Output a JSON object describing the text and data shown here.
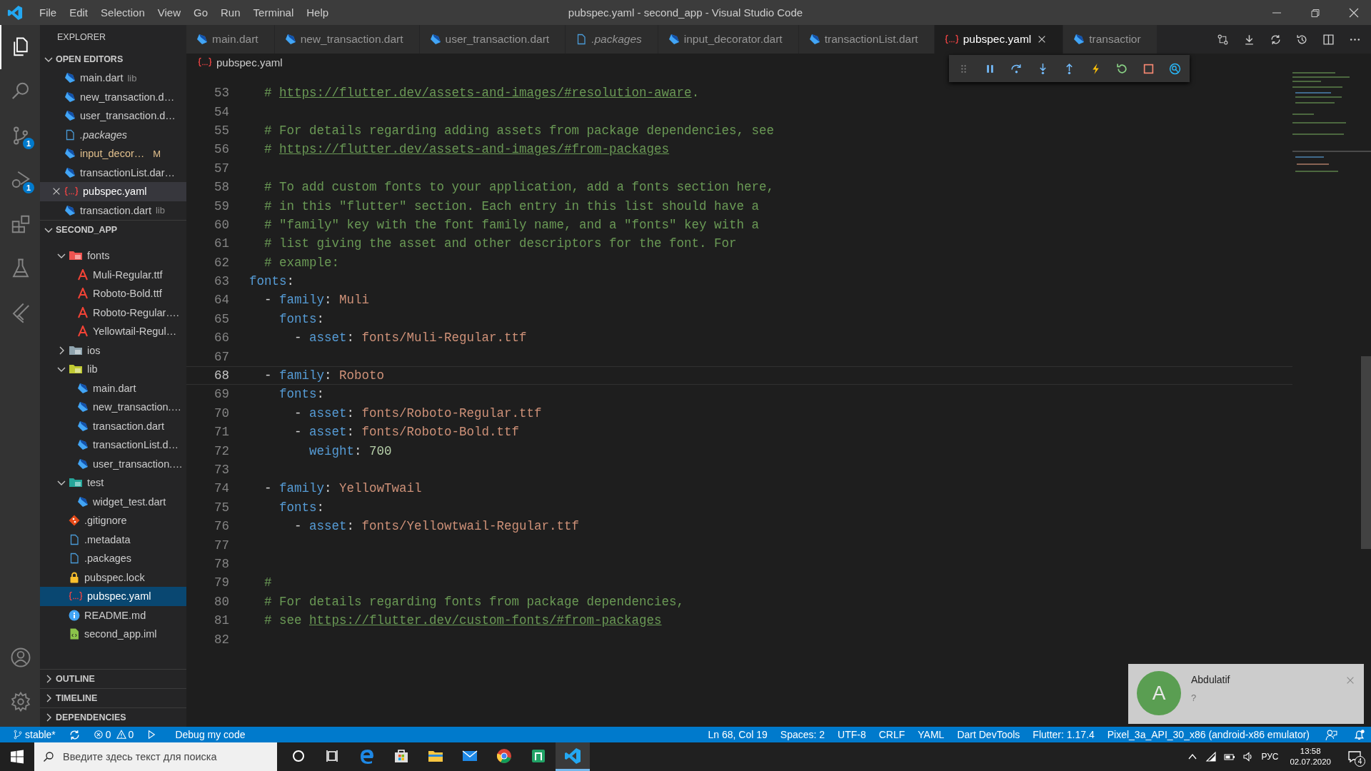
{
  "window": {
    "title": "pubspec.yaml - second_app - Visual Studio Code"
  },
  "menu": [
    "File",
    "Edit",
    "Selection",
    "View",
    "Go",
    "Run",
    "Terminal",
    "Help"
  ],
  "activity_bar": [
    {
      "kind": "explorer",
      "selected": true
    },
    {
      "kind": "search",
      "selected": false
    },
    {
      "kind": "source-control",
      "selected": false,
      "badge": "1"
    },
    {
      "kind": "run",
      "selected": false,
      "badge": "1"
    },
    {
      "kind": "extensions",
      "selected": false
    },
    {
      "kind": "testing",
      "selected": false
    },
    {
      "kind": "flutter",
      "selected": false
    }
  ],
  "activity_bar_bottom": [
    {
      "kind": "account"
    },
    {
      "kind": "settings"
    }
  ],
  "explorer": {
    "title": "EXPLORER",
    "open_editors": {
      "title": "OPEN EDITORS",
      "expanded": true,
      "items": [
        {
          "name": "main.dart",
          "kind": "dart",
          "detail": "lib",
          "preview": false,
          "selected": false
        },
        {
          "name": "new_transaction.d…",
          "kind": "dart",
          "preview": false,
          "selected": false
        },
        {
          "name": "user_transaction.d…",
          "kind": "dart",
          "preview": false,
          "selected": false
        },
        {
          "name": ".packages",
          "kind": "file",
          "preview": true,
          "selected": false
        },
        {
          "name": "input_decor…",
          "kind": "dart",
          "git_status": "M",
          "preview": false,
          "selected": false
        },
        {
          "name": "transactionList.dar…",
          "kind": "dart",
          "preview": false,
          "selected": false
        },
        {
          "name": "pubspec.yaml",
          "kind": "yaml",
          "preview": false,
          "selected": true
        },
        {
          "name": "transaction.dart",
          "kind": "dart",
          "detail": "lib",
          "preview": false,
          "selected": false
        }
      ]
    },
    "project": {
      "title": "SECOND_APP",
      "expanded": true,
      "tree": [
        {
          "name": "fonts",
          "kind": "folder-font",
          "expanded": true,
          "selected": false,
          "children": [
            {
              "name": "Muli-Regular.ttf",
              "kind": "font",
              "selected": false
            },
            {
              "name": "Roboto-Bold.ttf",
              "kind": "font",
              "selected": false
            },
            {
              "name": "Roboto-Regular….",
              "kind": "font",
              "selected": false
            },
            {
              "name": "Yellowtail-Regul…",
              "kind": "font",
              "selected": false
            }
          ]
        },
        {
          "name": "ios",
          "kind": "folder-ios",
          "expanded": false,
          "selected": false
        },
        {
          "name": "lib",
          "kind": "folder-lib",
          "expanded": true,
          "selected": false,
          "children": [
            {
              "name": "main.dart",
              "kind": "dart",
              "selected": false
            },
            {
              "name": "new_transaction.…",
              "kind": "dart",
              "selected": false
            },
            {
              "name": "transaction.dart",
              "kind": "dart",
              "selected": false
            },
            {
              "name": "transactionList.d…",
              "kind": "dart",
              "selected": false
            },
            {
              "name": "user_transaction.…",
              "kind": "dart",
              "selected": false
            }
          ]
        },
        {
          "name": "test",
          "kind": "folder-test",
          "expanded": true,
          "selected": false,
          "children": [
            {
              "name": "widget_test.dart",
              "kind": "dart",
              "selected": false
            }
          ]
        },
        {
          "name": ".gitignore",
          "kind": "git",
          "selected": false
        },
        {
          "name": ".metadata",
          "kind": "file",
          "selected": false
        },
        {
          "name": ".packages",
          "kind": "file",
          "selected": false
        },
        {
          "name": "pubspec.lock",
          "kind": "lock",
          "selected": false
        },
        {
          "name": "pubspec.yaml",
          "kind": "yaml",
          "selected": true
        },
        {
          "name": "README.md",
          "kind": "info",
          "selected": false
        },
        {
          "name": "second_app.iml",
          "kind": "iml",
          "selected": false
        }
      ]
    },
    "sections": [
      {
        "title": "OUTLINE",
        "expanded": false
      },
      {
        "title": "TIMELINE",
        "expanded": false
      },
      {
        "title": "DEPENDENCIES",
        "expanded": false
      }
    ]
  },
  "tabs": [
    {
      "label": "main.dart",
      "kind": "dart",
      "preview": false,
      "selected": false
    },
    {
      "label": "new_transaction.dart",
      "kind": "dart",
      "preview": false,
      "selected": false
    },
    {
      "label": "user_transaction.dart",
      "kind": "dart",
      "preview": false,
      "selected": false
    },
    {
      "label": ".packages",
      "kind": "file",
      "preview": true,
      "selected": false
    },
    {
      "label": "input_decorator.dart",
      "kind": "dart",
      "preview": false,
      "selected": false
    },
    {
      "label": "transactionList.dart",
      "kind": "dart",
      "preview": false,
      "selected": false
    },
    {
      "label": "pubspec.yaml",
      "kind": "yaml",
      "preview": false,
      "selected": true
    },
    {
      "label": "transactior",
      "kind": "dart",
      "preview": false,
      "selected": false
    }
  ],
  "tab_actions": [
    {
      "kind": "compare"
    },
    {
      "kind": "download"
    },
    {
      "kind": "sync"
    },
    {
      "kind": "history"
    },
    {
      "kind": "split"
    },
    {
      "kind": "more"
    }
  ],
  "debug_toolbar": [
    {
      "kind": "grip"
    },
    {
      "kind": "pause"
    },
    {
      "kind": "step-over"
    },
    {
      "kind": "step-into"
    },
    {
      "kind": "step-out"
    },
    {
      "kind": "hot-reload"
    },
    {
      "kind": "restart"
    },
    {
      "kind": "stop"
    },
    {
      "kind": "inspect"
    }
  ],
  "breadcrumb": {
    "kind": "yaml",
    "label": "pubspec.yaml"
  },
  "lines": [
    {
      "number": "53",
      "current": false,
      "tokens": [
        {
          "kind": "comment",
          "text": "  # "
        },
        {
          "kind": "link",
          "text": "https://flutter.dev/assets-and-images/#resolution-aware"
        },
        {
          "kind": "comment",
          "text": "."
        }
      ]
    },
    {
      "number": "54",
      "current": false
    },
    {
      "number": "55",
      "current": false,
      "tokens": [
        {
          "kind": "comment",
          "text": "  # For details regarding adding assets from package dependencies, see"
        }
      ]
    },
    {
      "number": "56",
      "current": false,
      "tokens": [
        {
          "kind": "comment",
          "text": "  # "
        },
        {
          "kind": "link",
          "text": "https://flutter.dev/assets-and-images/#from-packages"
        }
      ]
    },
    {
      "number": "57",
      "current": false
    },
    {
      "number": "58",
      "current": false,
      "tokens": [
        {
          "kind": "comment",
          "text": "  # To add custom fonts to your application, add a fonts section here,"
        }
      ]
    },
    {
      "number": "59",
      "current": false,
      "tokens": [
        {
          "kind": "comment",
          "text": "  # in this \"flutter\" section. Each entry in this list should have a"
        }
      ]
    },
    {
      "number": "60",
      "current": false,
      "tokens": [
        {
          "kind": "comment",
          "text": "  # \"family\" key with the font family name, and a \"fonts\" key with a"
        }
      ]
    },
    {
      "number": "61",
      "current": false,
      "tokens": [
        {
          "kind": "comment",
          "text": "  # list giving the asset and other descriptors for the font. For"
        }
      ]
    },
    {
      "number": "62",
      "current": false,
      "tokens": [
        {
          "kind": "comment",
          "text": "  # example:"
        }
      ]
    },
    {
      "number": "63",
      "current": false,
      "tokens": [
        {
          "kind": "key",
          "text": "fonts"
        },
        {
          "kind": "plain",
          "text": ":"
        }
      ]
    },
    {
      "number": "64",
      "current": false,
      "tokens": [
        {
          "kind": "plain",
          "text": "  - "
        },
        {
          "kind": "key",
          "text": "family"
        },
        {
          "kind": "plain",
          "text": ": "
        },
        {
          "kind": "value",
          "text": "Muli"
        }
      ]
    },
    {
      "number": "65",
      "current": false,
      "tokens": [
        {
          "kind": "key",
          "text": "    fonts"
        },
        {
          "kind": "plain",
          "text": ":"
        }
      ]
    },
    {
      "number": "66",
      "current": false,
      "tokens": [
        {
          "kind": "plain",
          "text": "      - "
        },
        {
          "kind": "key",
          "text": "asset"
        },
        {
          "kind": "plain",
          "text": ": "
        },
        {
          "kind": "value",
          "text": "fonts/Muli-Regular.ttf"
        }
      ]
    },
    {
      "number": "67",
      "current": false
    },
    {
      "number": "68",
      "current": true,
      "tokens": [
        {
          "kind": "plain",
          "text": "  - "
        },
        {
          "kind": "key",
          "text": "family"
        },
        {
          "kind": "plain",
          "text": ": "
        },
        {
          "kind": "value",
          "text": "Roboto"
        }
      ]
    },
    {
      "number": "69",
      "current": false,
      "tokens": [
        {
          "kind": "key",
          "text": "    fonts"
        },
        {
          "kind": "plain",
          "text": ":"
        }
      ]
    },
    {
      "number": "70",
      "current": false,
      "tokens": [
        {
          "kind": "plain",
          "text": "      - "
        },
        {
          "kind": "key",
          "text": "asset"
        },
        {
          "kind": "plain",
          "text": ": "
        },
        {
          "kind": "value",
          "text": "fonts/Roboto-Regular.ttf"
        }
      ]
    },
    {
      "number": "71",
      "current": false,
      "tokens": [
        {
          "kind": "plain",
          "text": "      - "
        },
        {
          "kind": "key",
          "text": "asset"
        },
        {
          "kind": "plain",
          "text": ": "
        },
        {
          "kind": "value",
          "text": "fonts/Roboto-Bold.ttf"
        }
      ]
    },
    {
      "number": "72",
      "current": false,
      "tokens": [
        {
          "kind": "key",
          "text": "        weight"
        },
        {
          "kind": "plain",
          "text": ": "
        },
        {
          "kind": "number",
          "text": "700"
        }
      ]
    },
    {
      "number": "73",
      "current": false
    },
    {
      "number": "74",
      "current": false,
      "tokens": [
        {
          "kind": "plain",
          "text": "  - "
        },
        {
          "kind": "key",
          "text": "family"
        },
        {
          "kind": "plain",
          "text": ": "
        },
        {
          "kind": "value",
          "text": "YellowTwail"
        }
      ]
    },
    {
      "number": "75",
      "current": false,
      "tokens": [
        {
          "kind": "key",
          "text": "    fonts"
        },
        {
          "kind": "plain",
          "text": ":"
        }
      ]
    },
    {
      "number": "76",
      "current": false,
      "tokens": [
        {
          "kind": "plain",
          "text": "      - "
        },
        {
          "kind": "key",
          "text": "asset"
        },
        {
          "kind": "plain",
          "text": ": "
        },
        {
          "kind": "value",
          "text": "fonts/Yellowtwail-Regular.ttf"
        }
      ]
    },
    {
      "number": "77",
      "current": false
    },
    {
      "number": "78",
      "current": false
    },
    {
      "number": "79",
      "current": false,
      "tokens": [
        {
          "kind": "comment",
          "text": "  #"
        }
      ]
    },
    {
      "number": "80",
      "current": false,
      "tokens": [
        {
          "kind": "comment",
          "text": "  # For details regarding fonts from package dependencies,"
        }
      ]
    },
    {
      "number": "81",
      "current": false,
      "tokens": [
        {
          "kind": "comment",
          "text": "  # see "
        },
        {
          "kind": "link",
          "text": "https://flutter.dev/custom-fonts/#from-packages"
        }
      ]
    },
    {
      "number": "82",
      "current": false
    }
  ],
  "status_bar": {
    "left": [
      {
        "kind": "branch",
        "label": "stable*"
      },
      {
        "kind": "sync"
      },
      {
        "kind": "problems",
        "errors": "0",
        "warnings": "0"
      },
      {
        "kind": "debug",
        "label": "Debug my code"
      }
    ],
    "right": [
      {
        "kind": "text",
        "label": "Ln 68, Col 19"
      },
      {
        "kind": "text",
        "label": "Spaces: 2"
      },
      {
        "kind": "text",
        "label": "UTF-8"
      },
      {
        "kind": "text",
        "label": "CRLF"
      },
      {
        "kind": "text",
        "label": "YAML"
      },
      {
        "kind": "text",
        "label": "Dart DevTools"
      },
      {
        "kind": "text",
        "label": "Flutter: 1.17.4"
      },
      {
        "kind": "text",
        "label": "Pixel_3a_API_30_x86 (android-x86 emulator)"
      },
      {
        "kind": "feedback"
      },
      {
        "kind": "bell"
      }
    ]
  },
  "notification": {
    "avatar": "A",
    "name": "Abdulatif",
    "message": "?"
  },
  "taskbar": {
    "search_placeholder": "Введите здесь текст для поиска",
    "apps": [
      {
        "kind": "cortana",
        "selected": false
      },
      {
        "kind": "task-view",
        "selected": false
      },
      {
        "kind": "edge",
        "selected": false
      },
      {
        "kind": "store",
        "selected": false
      },
      {
        "kind": "file-explorer",
        "selected": false
      },
      {
        "kind": "mail",
        "selected": false
      },
      {
        "kind": "chrome",
        "selected": false
      },
      {
        "kind": "app",
        "selected": false
      },
      {
        "kind": "vscode",
        "selected": true
      }
    ],
    "tray": {
      "language": "РУС",
      "time": "13:58",
      "date": "02.07.2020",
      "notifications": "4"
    }
  }
}
